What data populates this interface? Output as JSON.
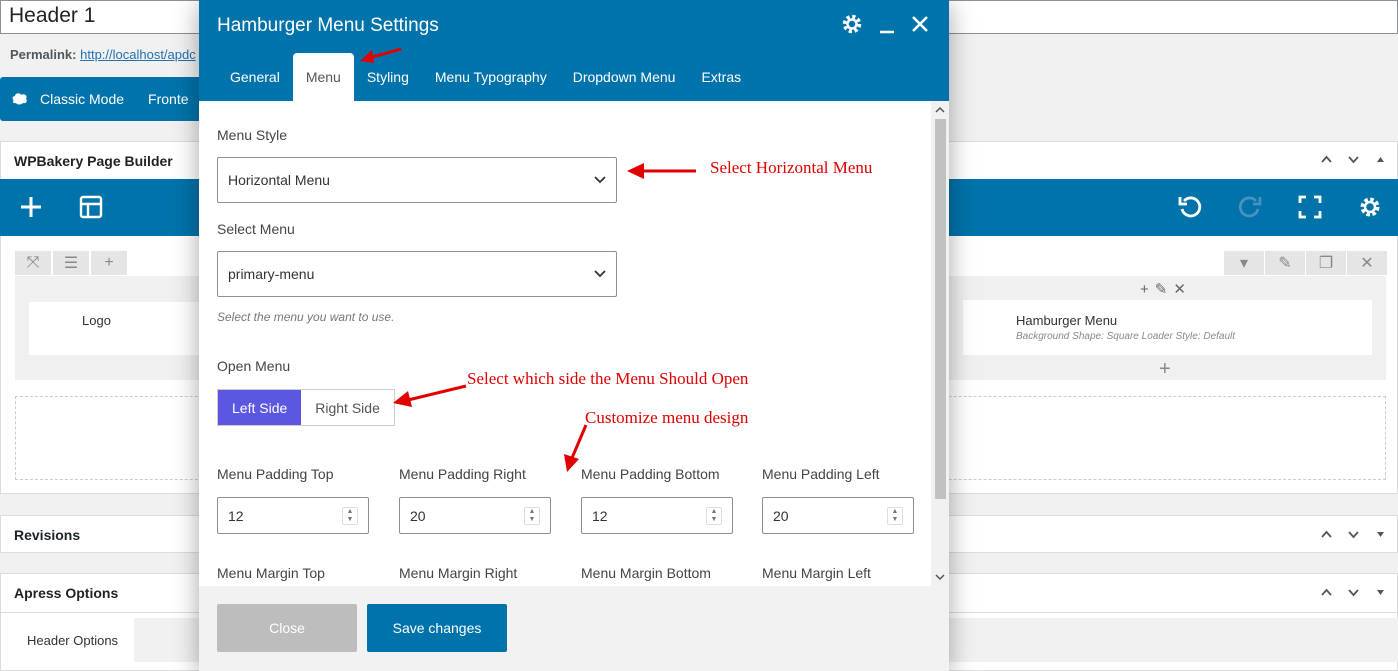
{
  "page": {
    "post_title": "Header 1",
    "permalink_label": "Permalink:",
    "permalink_url": "http://localhost/apdc",
    "mode_classic": "Classic Mode",
    "mode_frontend": "Fronte"
  },
  "builder": {
    "title": "WPBakery Page Builder",
    "logo_label": "Logo",
    "hamburger_title": "Hamburger Menu",
    "hamburger_meta": "Background Shape: Square  Loader Style: Default"
  },
  "revisions": {
    "title": "Revisions"
  },
  "apress": {
    "title": "Apress Options",
    "tab": "Header Options"
  },
  "modal": {
    "title": "Hamburger Menu Settings",
    "tabs": [
      {
        "label": "General"
      },
      {
        "label": "Menu"
      },
      {
        "label": "Styling"
      },
      {
        "label": "Menu Typography"
      },
      {
        "label": "Dropdown Menu"
      },
      {
        "label": "Extras"
      }
    ],
    "active_tab": "Menu",
    "menu_style_label": "Menu Style",
    "menu_style_value": "Horizontal Menu",
    "select_menu_label": "Select Menu",
    "select_menu_value": "primary-menu",
    "select_menu_hint": "Select the menu you want to use.",
    "open_menu_label": "Open Menu",
    "open_left": "Left Side",
    "open_right": "Right Side",
    "open_selected": "Left Side",
    "padding": [
      {
        "label": "Menu Padding Top",
        "value": "12"
      },
      {
        "label": "Menu Padding Right",
        "value": "20"
      },
      {
        "label": "Menu Padding Bottom",
        "value": "12"
      },
      {
        "label": "Menu Padding Left",
        "value": "20"
      }
    ],
    "margin": [
      {
        "label": "Menu Margin Top"
      },
      {
        "label": "Menu Margin Right"
      },
      {
        "label": "Menu Margin Bottom"
      },
      {
        "label": "Menu Margin Left"
      }
    ],
    "close_label": "Close",
    "save_label": "Save changes"
  },
  "annotations": {
    "horizontal": "Select Horizontal Menu",
    "side": "Select which side the Menu Should Open",
    "design": "Customize menu design"
  },
  "colors": {
    "brand": "#0073aa",
    "toggle_active": "#5b57e1",
    "annotation": "#e00000"
  }
}
